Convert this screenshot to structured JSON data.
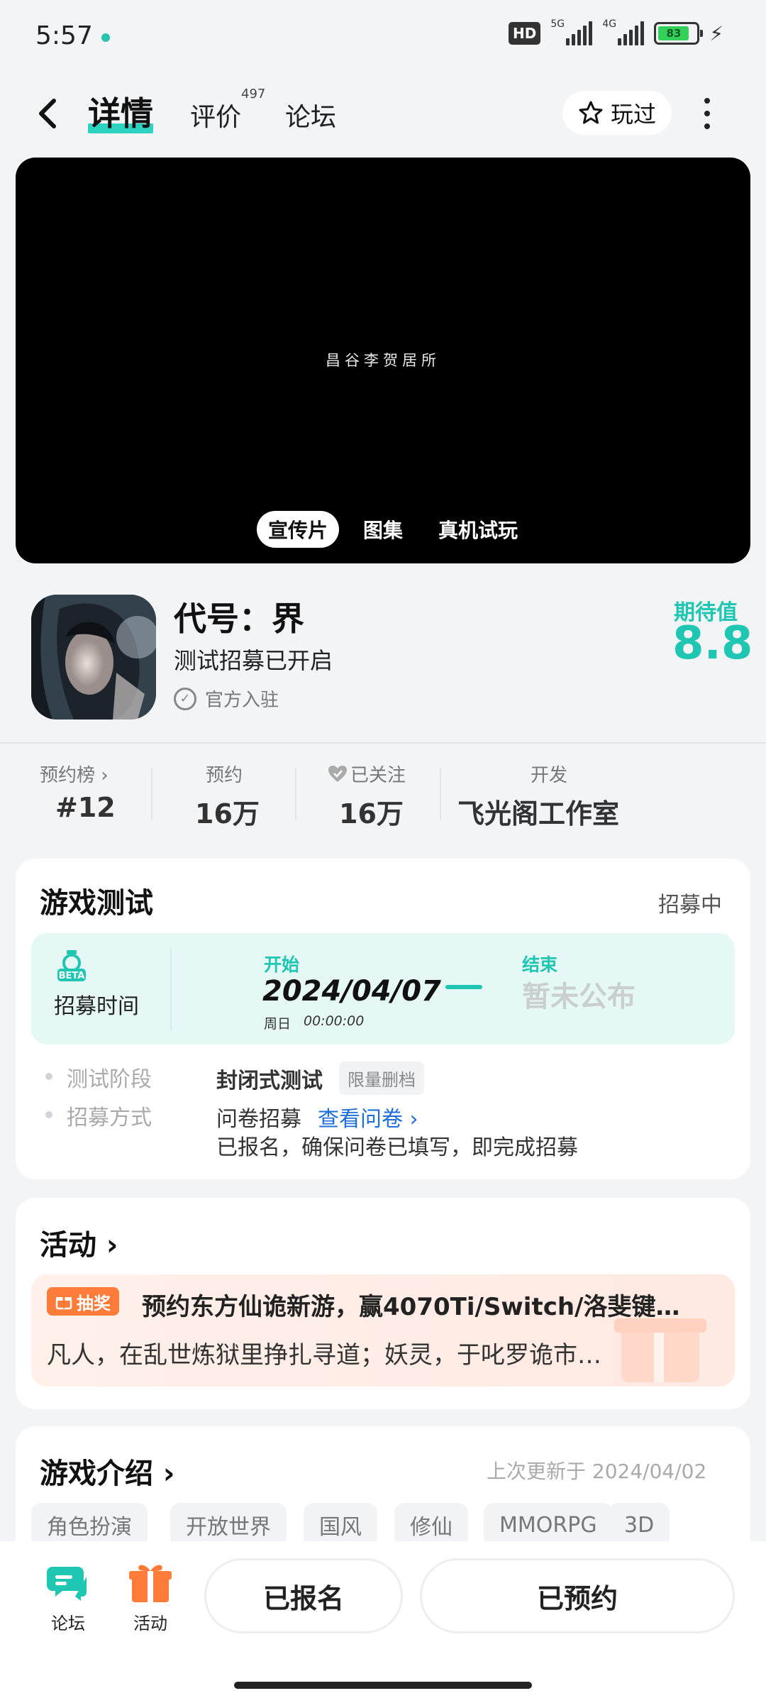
{
  "status_bar": {
    "time": "5:57",
    "hd_badge": "HD",
    "signal1_label": "5G",
    "signal2_label": "4G",
    "battery_level": "83"
  },
  "nav": {
    "tabs": [
      {
        "label": "详情",
        "active": true
      },
      {
        "label": "评价",
        "badge": "497"
      },
      {
        "label": "论坛"
      }
    ],
    "played_label": "玩过"
  },
  "video": {
    "caption": "昌谷李贺居所",
    "media_tabs": [
      "宣传片",
      "图集",
      "真机试玩"
    ]
  },
  "game": {
    "title": "代号：界",
    "subtitle": "测试招募已开启",
    "official": "官方入驻",
    "score_label": "期待值",
    "score_value": "8.8"
  },
  "stats": [
    {
      "label": "预约榜",
      "value": "#12",
      "chevron": true
    },
    {
      "label": "预约",
      "value": "16万"
    },
    {
      "label": "已关注",
      "value": "16万",
      "heart": true
    },
    {
      "label": "开发",
      "value": "飞光阁工作室"
    }
  ],
  "test": {
    "title": "游戏测试",
    "status": "招募中",
    "beta_badge": "BETA",
    "recruit_time_label": "招募时间",
    "start_label": "开始",
    "start_date": "2024/04/07",
    "start_weekday": "周日",
    "start_clock": "00:00:00",
    "end_label": "结束",
    "end_value": "暂未公布",
    "stage_label": "测试阶段",
    "stage_value": "封闭式测试",
    "stage_tag": "限量删档",
    "method_label": "招募方式",
    "method_value": "问卷招募",
    "method_link": "查看问卷",
    "method_desc": "已报名，确保问卷已填写，即完成招募"
  },
  "activity": {
    "title": "活动",
    "tag": "抽奖",
    "headline": "预约东方仙诡新游，赢4070Ti/Switch/洛斐键…",
    "text": "凡人，在乱世炼狱里挣扎寻道；妖灵，于叱罗诡市…"
  },
  "intro": {
    "title": "游戏介绍",
    "updated": "上次更新于 2024/04/02",
    "tags": [
      "角色扮演",
      "开放世界",
      "国风",
      "修仙",
      "MMORPG",
      "3D"
    ]
  },
  "bottom": {
    "forum_label": "论坛",
    "activity_label": "活动",
    "registered_label": "已报名",
    "reserved_label": "已预约"
  },
  "colors": {
    "accent": "#1fc6b2",
    "link": "#1f6fd9",
    "lottery": "#ff7b39"
  }
}
